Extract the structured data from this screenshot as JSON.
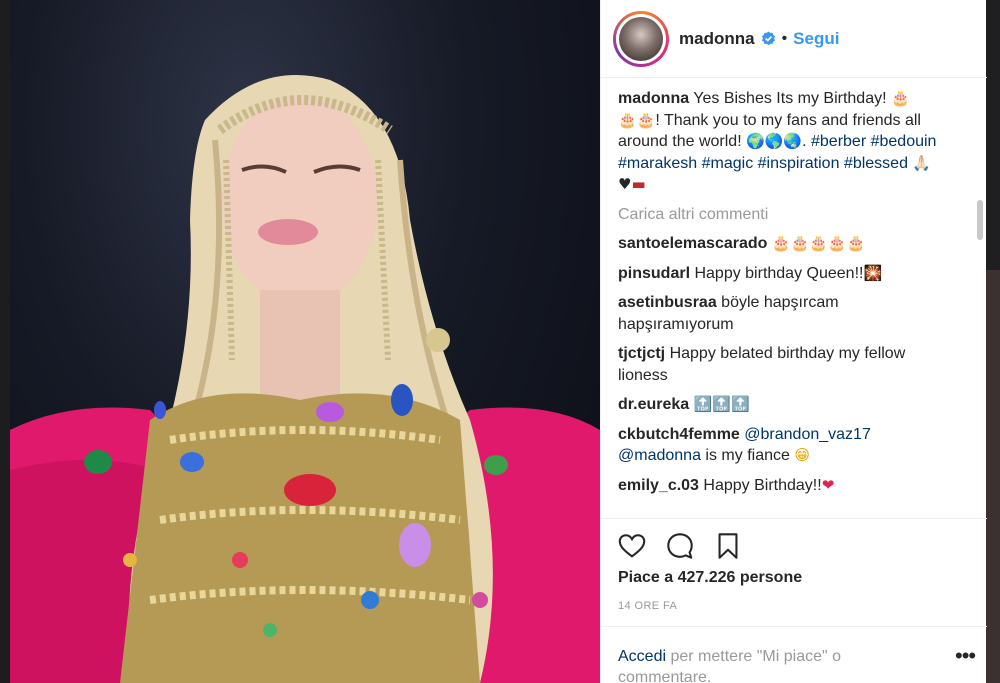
{
  "colors": {
    "link": "#3897f0",
    "hashtag": "#003569",
    "muted": "#999999",
    "text": "#262626"
  },
  "photo": {
    "description_icon": "post-photo"
  },
  "header": {
    "username": "madonna",
    "verified_icon": "verified-badge-icon",
    "separator": "•",
    "follow_label": "Segui"
  },
  "caption": {
    "username": "madonna",
    "text_1": " Yes Bishes Its my Birthday! ",
    "emoji_cake_1": "🎂",
    "emoji_cake_2": "🎂🎂",
    "text_2": "! Thank you to my fans and friends all around the world! ",
    "emoji_globes": "🌍🌎🌏",
    "text_3": ". ",
    "hashtags_1": "#berber",
    "hashtags_2": "#bedouin",
    "hashtags_3": "#marakesh",
    "hashtags_4": "#magic",
    "hashtags_5": "#inspiration",
    "hashtags_6": "#blessed",
    "emoji_end": "🙏🏻 ♥",
    "emoji_flag": "▬"
  },
  "load_more": "Carica altri commenti",
  "comments": [
    {
      "username": "santoelemascarado",
      "text": "",
      "emoji": "🎂🎂🎂🎂🎂"
    },
    {
      "username": "pinsudarl",
      "text": " Happy birthday Queen!!",
      "emoji": "🎇"
    },
    {
      "username": "asetinbusraa",
      "text": " böyle hapşırcam hapşıramıyorum",
      "emoji": ""
    },
    {
      "username": "tjctjctj",
      "text": " Happy belated birthday my fellow lioness",
      "emoji": ""
    },
    {
      "username": "dr.eureka",
      "text": " ",
      "emoji": "🔝🔝🔝"
    },
    {
      "username": "ckbutch4femme",
      "mention_1": "@brandon_vaz17",
      "mention_2": "@madonna",
      "text": " is my fiance ",
      "emoji": "😁"
    },
    {
      "username": "emily_c.03",
      "text": " Happy Birthday!!",
      "emoji": "❤"
    }
  ],
  "likes": "Piace a 427.226 persone",
  "timestamp": "14 ORE FA",
  "login_prompt": {
    "link": "Accedi",
    "text": " per mettere \"Mi piace\" o commentare."
  },
  "more_options": "•••"
}
